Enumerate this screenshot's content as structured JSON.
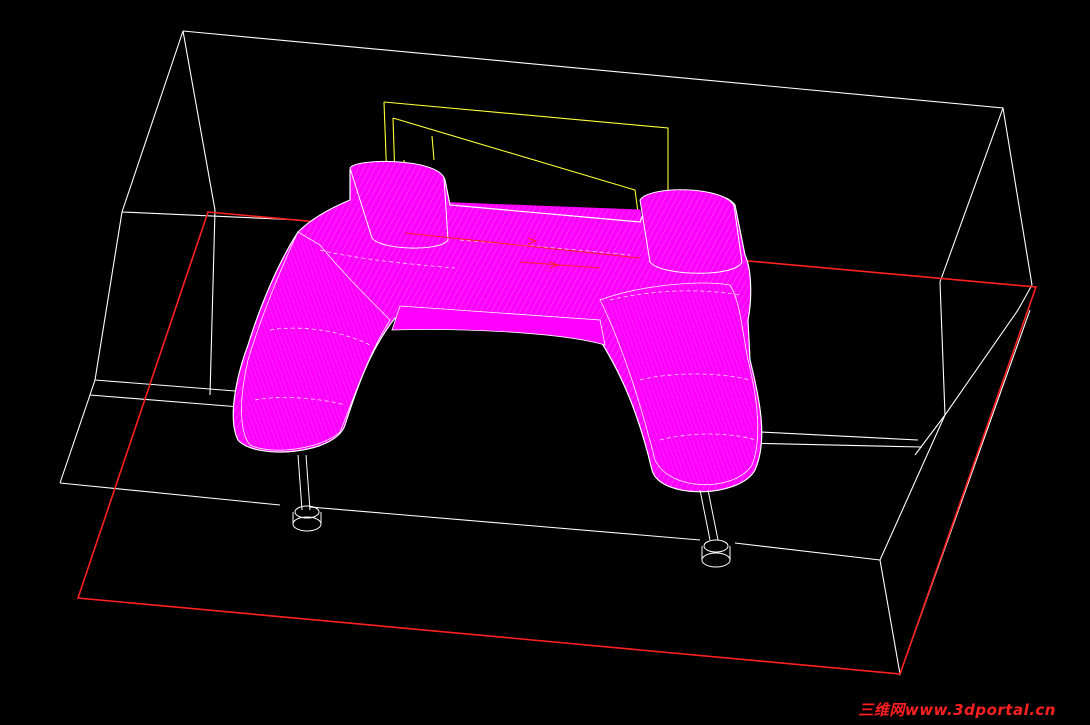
{
  "viewport": {
    "background": "#000000",
    "colors": {
      "wire": "#ffffff",
      "parting_line": "#ff2020",
      "part_toolpath": "#ff00ff",
      "part_highlight": "#ffffff",
      "guide_curve": "#ffff33",
      "gate_marker": "#ff2020"
    }
  },
  "objects": {
    "mold_block": "mold-block-wireframe",
    "parting_plane": "parting-plane",
    "part": "gamepad-toolpath",
    "ejector_pins": "ejector-pin"
  },
  "watermark": {
    "text": "三维网www.3dportal.cn",
    "color": "#ff2020"
  }
}
